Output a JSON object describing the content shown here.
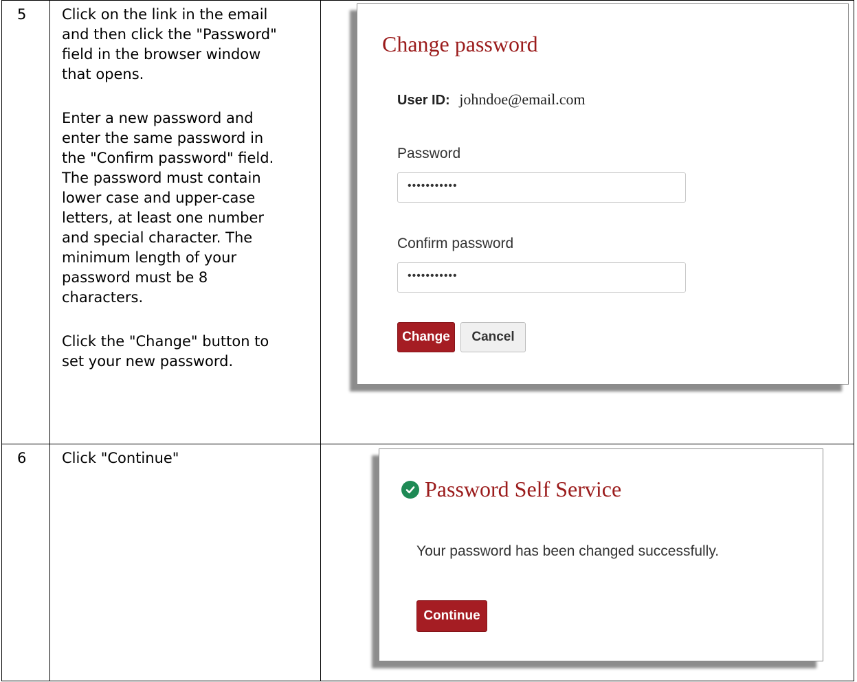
{
  "steps": [
    {
      "number": "5",
      "paragraphs": [
        [
          "Click on the link in the email",
          "and then click the \"Password\"",
          "field in the browser window",
          "that opens."
        ],
        [
          "Enter a new password and",
          "enter the same password in",
          "the \"Confirm password\" field.",
          "The password must contain",
          "lower case and upper-case",
          "letters, at least one number",
          "and special character. The",
          "minimum length of your",
          "password must be 8",
          "characters."
        ],
        [
          "Click the \"Change\" button to",
          "set your new password."
        ]
      ]
    },
    {
      "number": "6",
      "paragraphs": [
        [
          "Click \"Continue\""
        ]
      ]
    }
  ],
  "change_password_screen": {
    "title": "Change password",
    "user_id_label": "User ID:",
    "user_id_value": "johndoe@email.com",
    "password_label": "Password",
    "password_value": "•••••••••••",
    "confirm_label": "Confirm password",
    "confirm_value": "•••••••••••",
    "change_button": "Change",
    "cancel_button": "Cancel"
  },
  "success_screen": {
    "title": "Password Self Service",
    "message": "Your password has been changed successfully.",
    "continue_button": "Continue"
  },
  "colors": {
    "brand_red": "#a51d23",
    "title_red": "#9b1c1c",
    "success_green": "#1e8a55"
  }
}
